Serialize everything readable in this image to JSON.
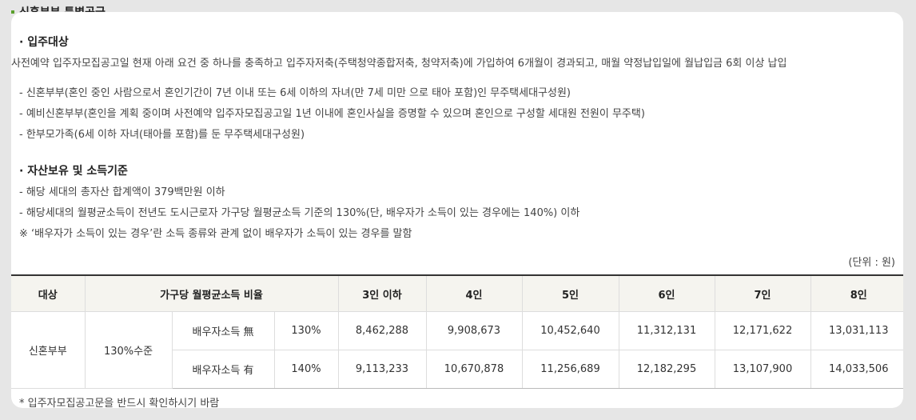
{
  "section_title": "신혼부부 특별공급",
  "move_in": {
    "title": "· 입주대상",
    "description": "사전예약 입주자모집공고일 현재 아래 요건 중 하나를 충족하고 입주자저축(주택청약종합저축, 청약저축)에 가입하여 6개월이 경과되고, 매월 약정납입일에 월납입금 6회 이상 납입",
    "items": [
      "- 신혼부부(혼인 중인 사람으로서 혼인기간이 7년 이내 또는 6세 이하의 자녀(만 7세 미만 으로 태아 포함)인 무주택세대구성원)",
      "- 예비신혼부부(혼인을 계획 중이며 사전예약 입주자모집공고일 1년 이내에 혼인사실을 증명할 수 있으며 혼인으로 구성할 세대원 전원이 무주택)",
      "- 한부모가족(6세 이하 자녀(태아를 포함)를 둔 무주택세대구성원)"
    ]
  },
  "asset": {
    "title": "· 자산보유 및 소득기준",
    "items": [
      "- 해당 세대의 총자산 합계액이 379백만원 이하",
      "- 해당세대의 월평균소득이 전년도 도시근로자 가구당 월평균소득 기준의 130%(단, 배우자가 소득이 있는 경우에는 140%) 이하",
      "※ ‘배우자가 소득이 있는 경우’란 소득 종류와 관계 없이 배우자가 소득이 있는 경우를 말함"
    ]
  },
  "unit_label": "(단위 : 원)",
  "table": {
    "headers": [
      "대상",
      "가구당 월평균소득 비율",
      "3인 이하",
      "4인",
      "5인",
      "6인",
      "7인",
      "8인"
    ],
    "target": "신혼부부",
    "level": "130%수준",
    "rows": [
      {
        "label": "배우자소득 無",
        "rate": "130%",
        "values": [
          "8,462,288",
          "9,908,673",
          "10,452,640",
          "11,312,131",
          "12,171,622",
          "13,031,113"
        ]
      },
      {
        "label": "배우자소득 有",
        "rate": "140%",
        "values": [
          "9,113,233",
          "10,670,878",
          "11,256,689",
          "12,182,295",
          "13,107,900",
          "14,033,506"
        ]
      }
    ]
  },
  "footnote": "* 입주자모집공고문을 반드시 확인하시기 바람"
}
